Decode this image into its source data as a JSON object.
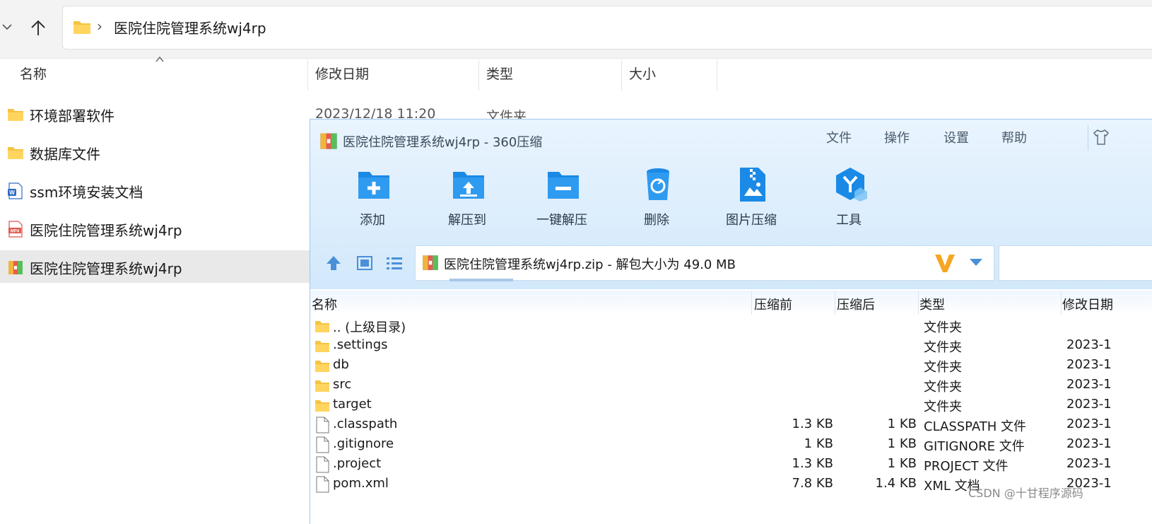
{
  "explorer": {
    "breadcrumb_sep": "›",
    "address_path": "医院住院管理系统wj4rp",
    "columns": {
      "name": "名称",
      "modified": "修改日期",
      "type": "类型",
      "size": "大小"
    },
    "files": [
      {
        "name": "环境部署软件",
        "icon": "folder-icon",
        "date": "2023/12/18 11:20",
        "type": "文件夹"
      },
      {
        "name": "数据库文件",
        "icon": "folder-icon"
      },
      {
        "name": "ssm环境安装文档",
        "icon": "word-doc-icon"
      },
      {
        "name": "医院住院管理系统wj4rp",
        "icon": "mp4-icon"
      },
      {
        "name": "医院住院管理系统wj4rp",
        "icon": "zip-archive-icon",
        "selected": true
      }
    ]
  },
  "zip_window": {
    "title": "医院住院管理系统wj4rp - 360压缩",
    "menu": [
      "文件",
      "操作",
      "设置",
      "帮助"
    ],
    "toolbar": [
      {
        "label": "添加",
        "icon": "add-folder-icon"
      },
      {
        "label": "解压到",
        "icon": "extract-to-icon"
      },
      {
        "label": "一键解压",
        "icon": "one-click-extract-icon"
      },
      {
        "label": "删除",
        "icon": "recycle-bin-icon"
      },
      {
        "label": "图片压缩",
        "icon": "image-compress-icon"
      },
      {
        "label": "工具",
        "icon": "tools-icon"
      }
    ],
    "address_text": "医院住院管理系统wj4rp.zip - 解包大小为 49.0 MB",
    "columns": {
      "name": "名称",
      "before": "压缩前",
      "after": "压缩后",
      "type": "类型",
      "modified": "修改日期"
    },
    "rows": [
      {
        "name": ".. (上级目录)",
        "icon": "folder-icon",
        "before": "",
        "after": "",
        "type": "文件夹",
        "date": ""
      },
      {
        "name": ".settings",
        "icon": "folder-icon",
        "before": "",
        "after": "",
        "type": "文件夹",
        "date": "2023-1"
      },
      {
        "name": "db",
        "icon": "folder-icon",
        "before": "",
        "after": "",
        "type": "文件夹",
        "date": "2023-1"
      },
      {
        "name": "src",
        "icon": "folder-icon",
        "before": "",
        "after": "",
        "type": "文件夹",
        "date": "2023-1"
      },
      {
        "name": "target",
        "icon": "folder-icon",
        "before": "",
        "after": "",
        "type": "文件夹",
        "date": "2023-1"
      },
      {
        "name": ".classpath",
        "icon": "file-icon",
        "before": "1.3 KB",
        "after": "1 KB",
        "type": "CLASSPATH 文件",
        "date": "2023-1"
      },
      {
        "name": ".gitignore",
        "icon": "file-icon",
        "before": "1 KB",
        "after": "1 KB",
        "type": "GITIGNORE 文件",
        "date": "2023-1"
      },
      {
        "name": ".project",
        "icon": "file-icon",
        "before": "1.3 KB",
        "after": "1 KB",
        "type": "PROJECT 文件",
        "date": "2023-1"
      },
      {
        "name": "pom.xml",
        "icon": "file-icon",
        "before": "7.8 KB",
        "after": "1.4 KB",
        "type": "XML 文档",
        "date": "2023-1"
      }
    ]
  },
  "watermark": "CSDN @十甘程序源码",
  "colors": {
    "zip_bg": "#dcedfc",
    "folder": "#f6c343",
    "accent_blue": "#1e88e5",
    "selected_row": "#e9e9e9"
  }
}
